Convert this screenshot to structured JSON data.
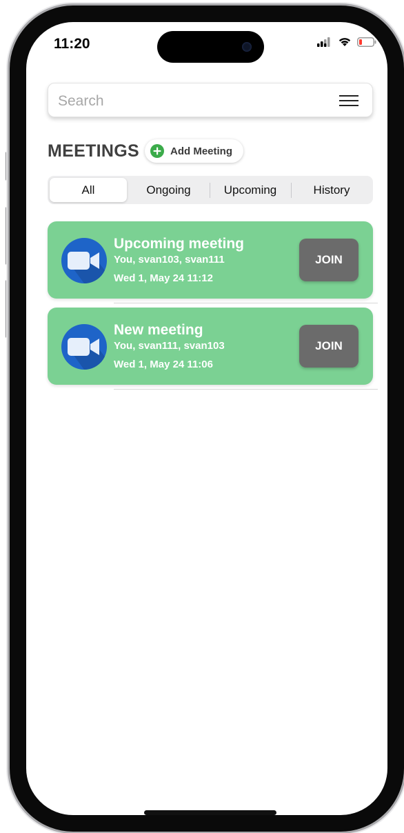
{
  "status_bar": {
    "time": "11:20",
    "icons": [
      "signal-icon",
      "wifi-icon",
      "battery-low-icon"
    ],
    "battery_color": "#ff3b30"
  },
  "search": {
    "placeholder": "Search",
    "value": ""
  },
  "header": {
    "title": "MEETINGS",
    "add_meeting_label": "Add Meeting"
  },
  "tabs": [
    {
      "label": "All",
      "active": true
    },
    {
      "label": "Ongoing",
      "active": false
    },
    {
      "label": "Upcoming",
      "active": false
    },
    {
      "label": "History",
      "active": false
    }
  ],
  "meetings": [
    {
      "title": "Upcoming meeting",
      "participants": "You, svan103, svan111",
      "datetime": "Wed 1, May 24 11:12",
      "action_label": "JOIN"
    },
    {
      "title": "New meeting",
      "participants": "You, svan111, svan103",
      "datetime": "Wed 1, May 24 11:06",
      "action_label": "JOIN"
    }
  ],
  "colors": {
    "card_background": "#7bd193",
    "join_button": "#6b6b6b",
    "video_icon_bg": "#1e64c8",
    "add_icon": "#3bab4a",
    "title_text": "#404040"
  }
}
